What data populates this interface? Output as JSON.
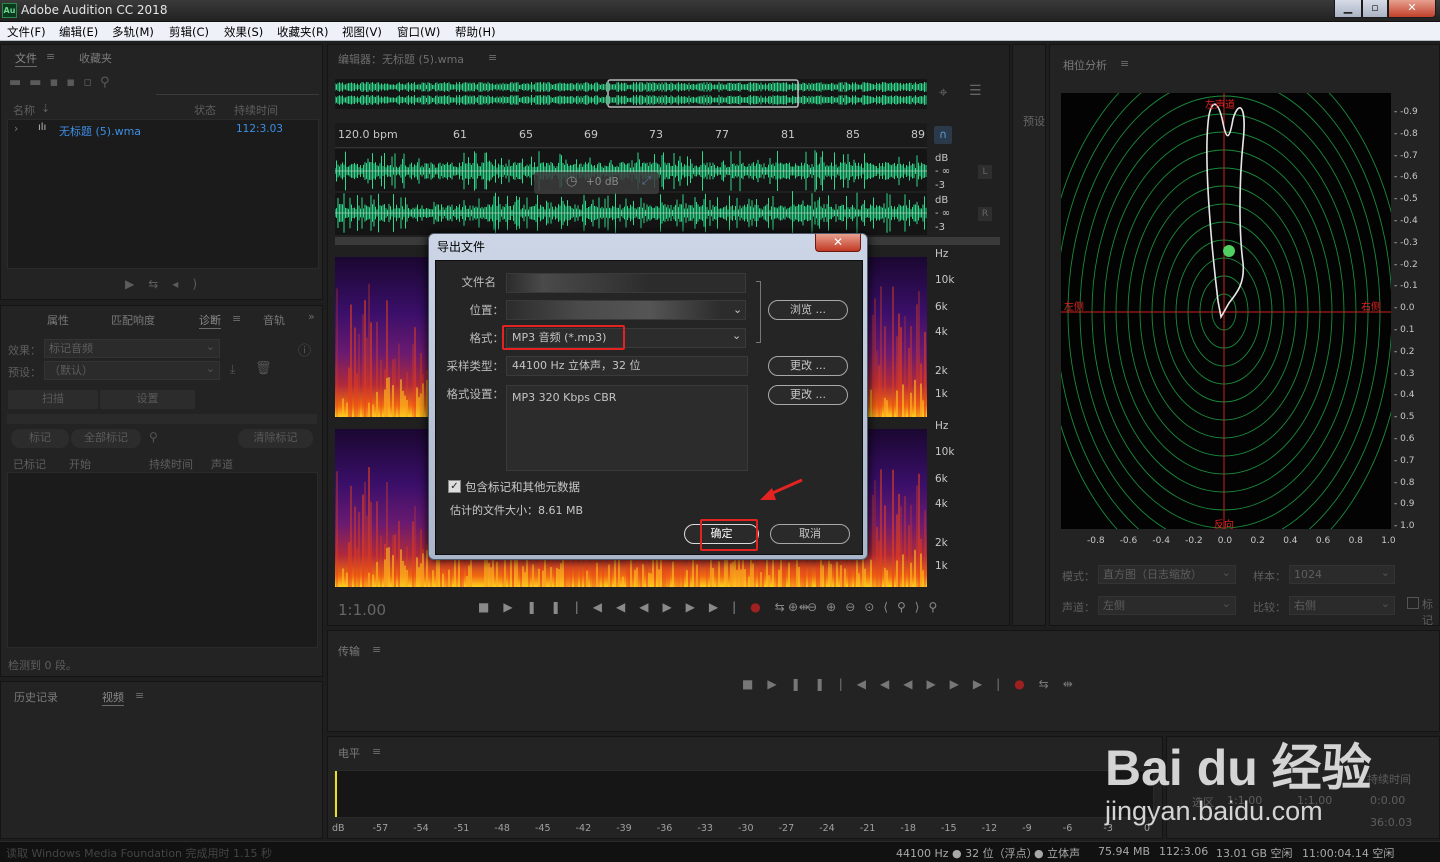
{
  "window": {
    "title": "Adobe Audition CC 2018",
    "icon_text": "Au",
    "min": "▁",
    "max": "▫",
    "close": "✕"
  },
  "menu": [
    "文件(F)",
    "编辑(E)",
    "多轨(M)",
    "剪辑(C)",
    "效果(S)",
    "收藏夹(R)",
    "视图(V)",
    "窗口(W)",
    "帮助(H)"
  ],
  "files_panel": {
    "tabs": [
      "文件",
      "收藏夹"
    ],
    "columns": [
      "名称",
      "状态",
      "持续时间"
    ],
    "file": {
      "name": "无标题 (5).wma",
      "duration": "112:3.03"
    }
  },
  "diag_panel": {
    "tabs": [
      "属性",
      "匹配响度",
      "诊断",
      "音轨"
    ],
    "effect_label": "效果：",
    "effect_value": "标记音频",
    "preset_label": "预设：",
    "preset_value": "（默认）",
    "scan": "扫描",
    "settings": "设置",
    "mark": "标记",
    "mark_all": "全部标记",
    "clear_marks": "清除标记",
    "columns": [
      "已标记",
      "开始",
      "持续时间",
      "声道"
    ],
    "detected": "检测到 0 段。"
  },
  "history_panel": {
    "tabs": [
      "历史记录",
      "视频"
    ]
  },
  "editor": {
    "title": "编辑器：无标题 (5).wma",
    "bpm": "120.0 bpm",
    "ruler": [
      "61",
      "65",
      "69",
      "73",
      "77",
      "81",
      "85",
      "89"
    ],
    "db_top": [
      "dB",
      "- ∞",
      "-3"
    ],
    "db_bottom": [
      "dB",
      "- ∞",
      "-3"
    ],
    "ch_l": "L",
    "ch_r": "R",
    "hud_gain": "+0 dB",
    "hz_top": [
      "Hz",
      "10k",
      "6k",
      "4k",
      "2k",
      "1k"
    ],
    "hz_bottom": [
      "Hz",
      "10k",
      "6k",
      "4k",
      "2k",
      "1k"
    ],
    "time": "1:1.00",
    "presets_label": "预设"
  },
  "dialog": {
    "title": "导出文件",
    "close": "✕",
    "filename_label": "文件名",
    "location_label": "位置：",
    "browse": "浏览 ...",
    "format_label": "格式：",
    "format_value": "MP3 音频 (*.mp3)",
    "sample_label": "采样类型：",
    "sample_value": "44100 Hz 立体声，32 位",
    "change1": "更改 ...",
    "format_settings_label": "格式设置：",
    "format_settings_value": "MP3 320 Kbps CBR",
    "change2": "更改 ...",
    "include_markers": "包含标记和其他元数据",
    "include_markers_checked": true,
    "estimated_size": "估计的文件大小：8.61 MB",
    "ok": "确定",
    "cancel": "取消"
  },
  "phase_panel": {
    "title": "相位分析",
    "label_top": "左声道",
    "label_left": "左侧",
    "label_right": "右侧",
    "label_bottom": "反向",
    "scale_right": [
      "-0.9",
      "-0.8",
      "-0.7",
      "-0.6",
      "-0.5",
      "-0.4",
      "-0.3",
      "-0.2",
      "-0.1",
      "0.0",
      "0.1",
      "0.2",
      "0.3",
      "0.4",
      "0.5",
      "0.6",
      "0.7",
      "0.8",
      "0.9",
      "1.0"
    ],
    "scale_bottom": [
      "-0.8",
      "-0.6",
      "-0.4",
      "-0.2",
      "0.0",
      "0.2",
      "0.4",
      "0.6",
      "0.8",
      "1.0"
    ],
    "mode_label": "模式：",
    "mode_value": "直方图（日志缩放）",
    "sample_label": "样本：",
    "sample_value": "1024",
    "channel_label": "声道：",
    "channel_value": "左侧",
    "compare_label": "比较：",
    "compare_value": "右侧",
    "checkbox_label": "标记"
  },
  "transport_panel": {
    "title": "传输"
  },
  "level_panel": {
    "title": "电平",
    "scale": [
      "dB",
      "-57",
      "-54",
      "-51",
      "-48",
      "-45",
      "-42",
      "-39",
      "-36",
      "-33",
      "-30",
      "-27",
      "-24",
      "-21",
      "-18",
      "-15",
      "-12",
      "-9",
      "-6",
      "-3",
      "0"
    ]
  },
  "selection_panel": {
    "duration_label": "持续时间",
    "sel_label": "选区",
    "start": "1:1.00",
    "end": "1:1.00",
    "dur": "0:0.00",
    "total": "36:0.03"
  },
  "watermark": {
    "brand": "Bai du 经验",
    "url": "jingyan.baidu.com"
  },
  "status": {
    "message": "读取 Windows Media Foundation 完成用时 1.15 秒",
    "sample": "44100 Hz ● 32 位（浮点）",
    "channels": "● 立体声",
    "size": "75.94 MB",
    "duration": "112:3.06",
    "free": "13.01 GB 空闲",
    "free_time": "11:00:04.14 空闲"
  },
  "colors": {
    "waveform": "#2fd88a",
    "accent_red": "#e32222",
    "link_blue": "#3d8ee6"
  }
}
